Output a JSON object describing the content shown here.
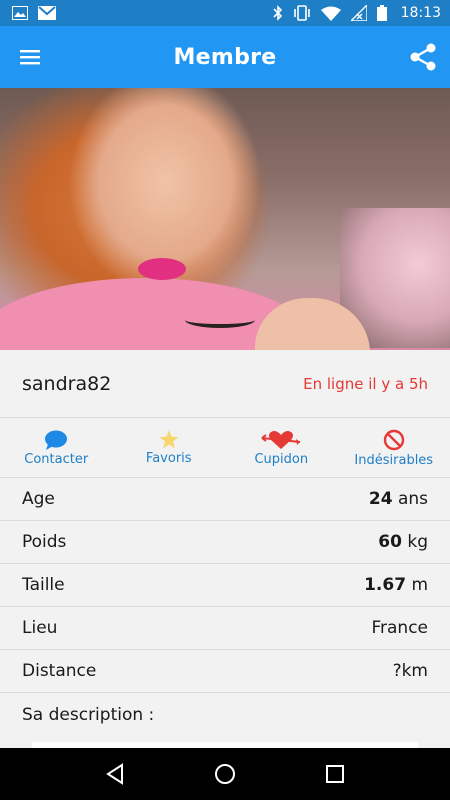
{
  "status_bar": {
    "time": "18:13",
    "icons": [
      "image-icon",
      "gmail-icon",
      "bluetooth-icon",
      "vibrate-icon",
      "wifi-icon",
      "signal-icon",
      "battery-icon"
    ]
  },
  "app_bar": {
    "title": "Membre",
    "left_icon": "menu-icon",
    "right_icon": "share-icon"
  },
  "profile": {
    "username": "sandra82",
    "online_status": "En ligne il y a 5h"
  },
  "actions": [
    {
      "label": "Contacter",
      "icon": "chat-bubble-icon",
      "color": "#1e88e5"
    },
    {
      "label": "Favoris",
      "icon": "star-icon",
      "color": "#f5d76e"
    },
    {
      "label": "Cupidon",
      "icon": "cupid-heart-icon",
      "color": "#e53935"
    },
    {
      "label": "Indésirables",
      "icon": "block-icon",
      "color": "#e53935"
    }
  ],
  "details": {
    "age": {
      "label": "Age",
      "value": "24",
      "unit": "ans"
    },
    "poids": {
      "label": "Poids",
      "value": "60",
      "unit": "kg"
    },
    "taille": {
      "label": "Taille",
      "value": "1.67",
      "unit": "m"
    },
    "lieu": {
      "label": "Lieu",
      "value": "France"
    },
    "distance": {
      "label": "Distance",
      "value": "?km"
    },
    "description_label": "Sa description :"
  },
  "colors": {
    "primary": "#2196f3",
    "status_bar": "#1e7fc7",
    "online_red": "#e53935",
    "link_blue": "#1e7fc7"
  }
}
